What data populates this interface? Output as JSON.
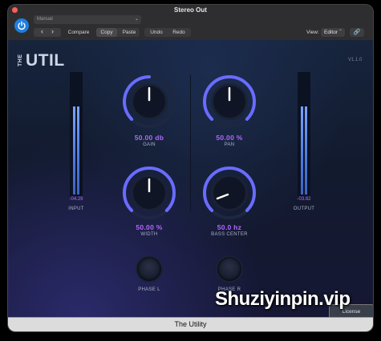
{
  "window": {
    "title": "Stereo Out"
  },
  "toolbar": {
    "preset_value": "Manual",
    "compare_label": "Compare",
    "copy_label": "Copy",
    "paste_label": "Paste",
    "undo_label": "Undo",
    "redo_label": "Redo",
    "view_label": "View:",
    "view_value": "Editor",
    "prev_glyph": "‹",
    "next_glyph": "›"
  },
  "plugin": {
    "logo_the": "THE",
    "logo_util": "UTIL",
    "version": "V1.1.0",
    "input_meter": {
      "value": "-04.29",
      "label": "INPUT"
    },
    "output_meter": {
      "value": "-03.82",
      "label": "OUTPUT"
    },
    "knobs": {
      "gain": {
        "value": "50.00  db",
        "label": "GAIN"
      },
      "pan": {
        "value": "50.00  %",
        "label": "PAN"
      },
      "width": {
        "value": "50.00  %",
        "label": "WIDTH"
      },
      "bass_center": {
        "value": "50.0  hz",
        "label": "BASS CENTER"
      }
    },
    "phase_l": {
      "label": "PHASE  L"
    },
    "phase_r": {
      "label": "PHASE  R"
    },
    "license_label": "License"
  },
  "footer": {
    "title": "The Utility"
  },
  "watermark": "Shuziyinpin.vip",
  "colors": {
    "accent": "#b366ff",
    "power": "#1d7fe0",
    "meter": "#5b86f0"
  }
}
